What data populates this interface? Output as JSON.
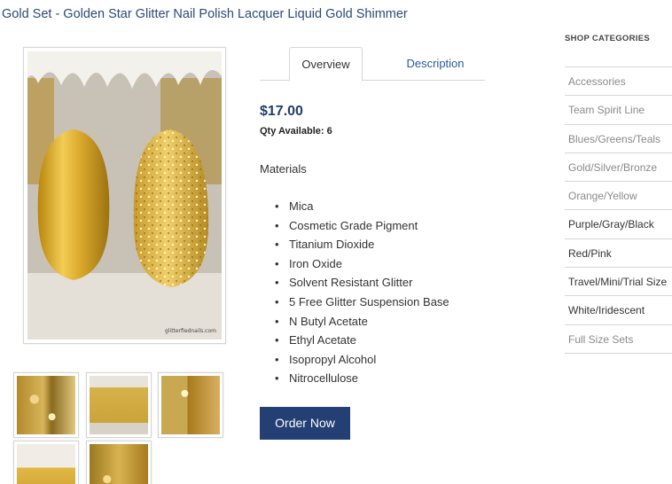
{
  "product": {
    "title": "Gold Set - Golden Star Glitter Nail Polish Lacquer Liquid Gold Shimmer",
    "price": "$17.00",
    "qty_label": "Qty Available:",
    "qty_value": "6",
    "image_watermark": "glitterfiednails.com"
  },
  "tabs": {
    "overview": "Overview",
    "description": "Description"
  },
  "materials": {
    "heading": "Materials",
    "items": [
      "Mica",
      "Cosmetic Grade Pigment",
      "Titanium Dioxide",
      "Iron Oxide",
      "Solvent Resistant Glitter",
      "5 Free Glitter Suspension Base",
      "N Butyl Acetate",
      "Ethyl Acetate",
      "Isopropyl Alcohol",
      "Nitrocellulose"
    ]
  },
  "order_button": "Order Now",
  "sidebar": {
    "heading": "SHOP CATEGORIES",
    "items": [
      "Accessories",
      "Team Spirit Line",
      "Blues/Greens/Teals",
      "Gold/Silver/Bronze",
      "Orange/Yellow",
      "Purple/Gray/Black",
      "Red/Pink",
      "Travel/Mini/Trial Size",
      "White/Iridescent",
      "Full Size Sets"
    ]
  },
  "colors": {
    "title": "#2a4a7b",
    "price": "#1f3d6e",
    "button_bg": "#233f73",
    "tab_link": "#2a5a9b"
  }
}
